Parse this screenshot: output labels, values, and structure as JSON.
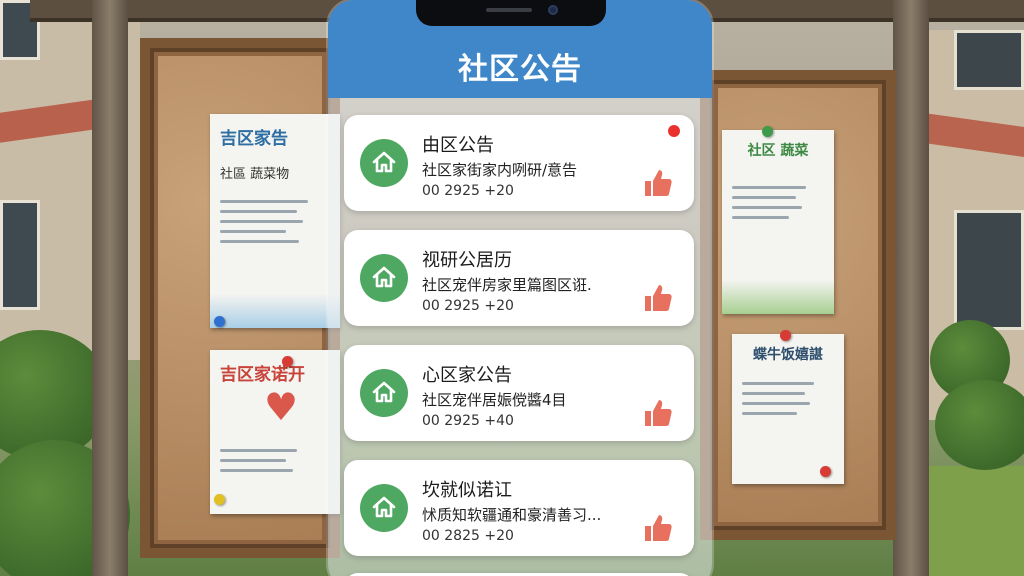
{
  "app": {
    "title": "社区公告"
  },
  "notices": [
    {
      "title": "由区公告",
      "summary": "社区家街家内咧研/意告",
      "meta": "00 2925 +20",
      "unread": true,
      "icon": "home-icon",
      "action_icon": "thumbs-up-icon"
    },
    {
      "title": "视研公居历",
      "summary": "社区宠伴房家里篇图区诳.",
      "meta": "00 2925 +20",
      "unread": false,
      "icon": "home-icon",
      "action_icon": "thumbs-up-icon"
    },
    {
      "title": "心区家公告",
      "summary": "社区宠伴居娠傥醬4目",
      "meta": "00 2925 +40",
      "unread": false,
      "icon": "home-icon",
      "action_icon": "thumbs-up-icon"
    },
    {
      "title": "坎就似诺讧",
      "summary": "怵质知软疆通和豪清善习...",
      "meta": "00 2825 +20",
      "unread": false,
      "icon": "home-icon",
      "action_icon": "thumbs-up-icon"
    }
  ],
  "board": {
    "poster_1": {
      "title": "吉区家告",
      "subtitle": "社區 蔬菜物"
    },
    "poster_2": {
      "title": "吉区家诺开"
    },
    "poster_3": {
      "title": "社区 蔬菜"
    },
    "poster_4": {
      "title": "蝶牛饭嬉諶"
    }
  },
  "colors": {
    "header": "#3f87c9",
    "avatar": "#4fa862",
    "thumb": "#e8705e",
    "unread_dot": "#e9322e"
  }
}
